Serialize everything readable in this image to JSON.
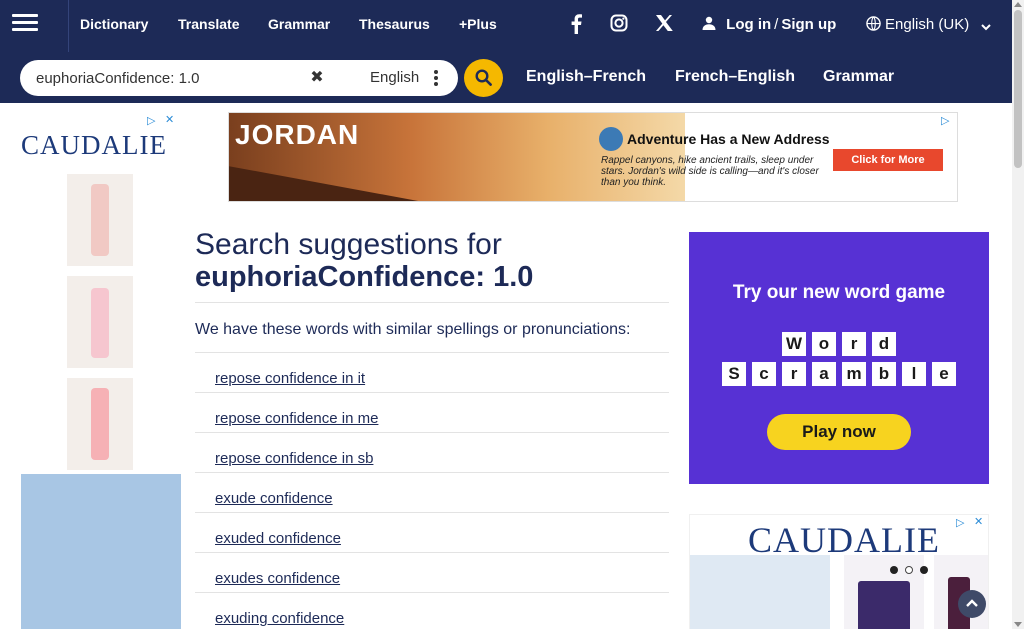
{
  "nav": {
    "menu_icon": "hamburger-menu-icon",
    "links": [
      "Dictionary",
      "Translate",
      "Grammar",
      "Thesaurus",
      "+Plus"
    ],
    "social_icons": [
      "facebook-icon",
      "instagram-icon",
      "x-twitter-icon"
    ],
    "login": "Log in",
    "separator": "/",
    "signup": "Sign up",
    "language": "English (UK)"
  },
  "search": {
    "value": "euphoriaConfidence: 1.0",
    "dictionary": "English",
    "tabs": [
      "English–French",
      "French–English",
      "Grammar"
    ]
  },
  "ads": {
    "left_brand": "CAUDALIE",
    "top_logo": "JORDAN",
    "top_headline": "Adventure Has a New Address",
    "top_sub": "Rappel canyons, hike ancient trails, sleep under stars. Jordan's wild side is calling—and it's closer than you think.",
    "top_cta": "Click for More",
    "game_headline": "Try our new word game",
    "game_row1": [
      "W",
      "o",
      "r",
      "d"
    ],
    "game_row2": [
      "S",
      "c",
      "r",
      "a",
      "m",
      "b",
      "l",
      "e"
    ],
    "game_cta": "Play now",
    "right_brand": "CAUDALIE"
  },
  "main": {
    "title_prefix": "Search suggestions for",
    "query": "euphoriaConfidence: 1.0",
    "intro": "We have these words with similar spellings or pronunciations:",
    "suggestions": [
      "repose confidence in it",
      "repose confidence in me",
      "repose confidence in sb",
      "exude confidence",
      "exuded confidence",
      "exudes confidence",
      "exuding confidence"
    ]
  },
  "colors": {
    "nav_bg": "#1d2a57",
    "accent_yellow": "#f5b800",
    "game_purple": "#5731d4"
  }
}
